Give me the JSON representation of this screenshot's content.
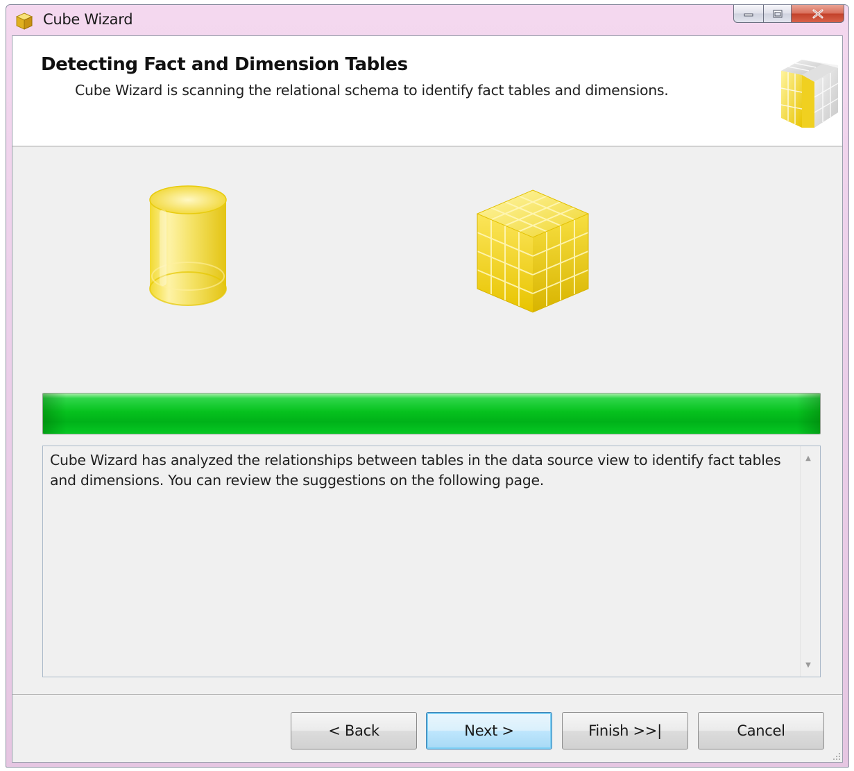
{
  "window": {
    "title": "Cube Wizard",
    "icons": {
      "app": "cube-app-icon",
      "minimize": "minimize-icon",
      "maximize": "maximize-icon",
      "close": "close-icon"
    }
  },
  "header": {
    "title": "Detecting Fact and Dimension Tables",
    "subtitle": "Cube Wizard is scanning the relational schema to identify fact tables and dimensions.",
    "icon": "cube-icon"
  },
  "graphics": {
    "left": "database-cylinder-icon",
    "right": "olap-cube-icon"
  },
  "progress": {
    "percent": 100,
    "color": "#00c020"
  },
  "message": {
    "text": "Cube Wizard has analyzed the relationships between tables in the data source view to identify fact tables and dimensions. You can review the suggestions on the following page."
  },
  "buttons": {
    "back": "< Back",
    "next": "Next >",
    "finish": "Finish >>|",
    "cancel": "Cancel"
  },
  "colors": {
    "accent_yellow": "#f0d020",
    "progress_green": "#00c020",
    "dialog_bg": "#f0f0f0"
  }
}
